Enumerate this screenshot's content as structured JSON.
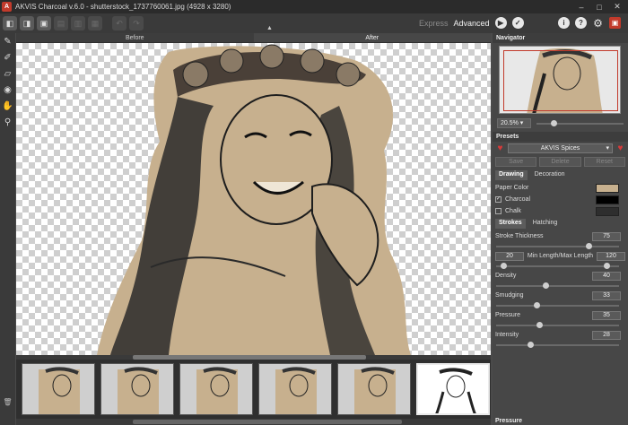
{
  "window": {
    "title": "AKVIS Charcoal v.6.0 - shutterstock_1737760061.jpg (4928 x 3280)",
    "icon_letter": "A",
    "min": "–",
    "max": "□",
    "close": "✕"
  },
  "toolbar": {
    "mode_express": "Express",
    "mode_advanced": "Advanced",
    "run_glyph": "▶",
    "apply_glyph": "✓"
  },
  "tabs": {
    "before": "Before",
    "after": "After"
  },
  "right_panel": {
    "navigator_title": "Navigator",
    "zoom_value": "20.5% ▾",
    "presets_title": "Presets",
    "preset_selected": "AKVIS Spices",
    "save": "Save",
    "delete": "Delete",
    "reset": "Reset",
    "tab_drawing": "Drawing",
    "tab_decoration": "Decoration",
    "paper_color_label": "Paper Color",
    "charcoal_label": "Charcoal",
    "chalk_label": "Chalk",
    "tab_strokes": "Strokes",
    "tab_hatching": "Hatching",
    "stroke_thickness_label": "Stroke Thickness",
    "stroke_thickness_value": "75",
    "min_length_value": "20",
    "min_max_label": "Min Length/Max Length",
    "max_length_value": "120",
    "density_label": "Density",
    "density_value": "40",
    "smudging_label": "Smudging",
    "smudging_value": "33",
    "pressure_label": "Pressure",
    "pressure_value": "35",
    "intensity_label": "Intensity",
    "intensity_value": "28",
    "pressure_footer": "Pressure",
    "charcoal_checked": "✓"
  },
  "colors": {
    "paper": "#c7b08e",
    "charcoal": "#000000",
    "chalk": "#2e2e2e",
    "accent": "#c23a2b"
  },
  "sliders": {
    "zoom": 0.2,
    "stroke_thickness": 0.75,
    "min_length": 0.06,
    "max_length": 0.9,
    "density": 0.4,
    "smudging": 0.33,
    "pressure": 0.35,
    "intensity": 0.28
  }
}
